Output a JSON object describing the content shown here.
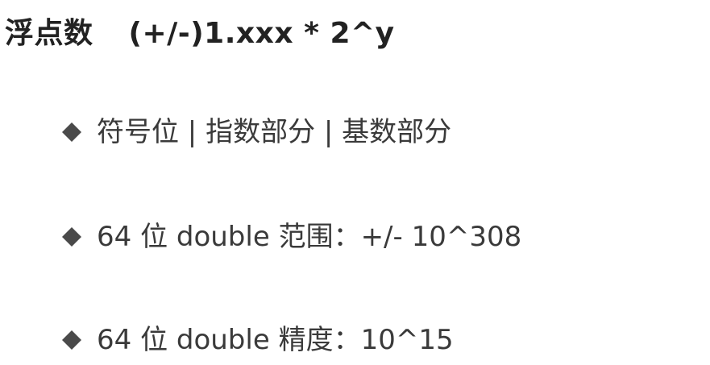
{
  "title": {
    "chinese": "浮点数",
    "formula": "(+/-)1.xxx * 2^y"
  },
  "bullets": [
    {
      "icon": "diamond-bullet-icon",
      "text": "符号位 | 指数部分 | 基数部分"
    },
    {
      "icon": "diamond-bullet-icon",
      "text": "64 位 double 范围：+/- 10^308"
    },
    {
      "icon": "diamond-bullet-icon",
      "text": "64 位 double 精度：10^15"
    }
  ],
  "colors": {
    "background": "#ffffff",
    "text": "#3a3a3a",
    "bullet": "#4a4a4a"
  }
}
